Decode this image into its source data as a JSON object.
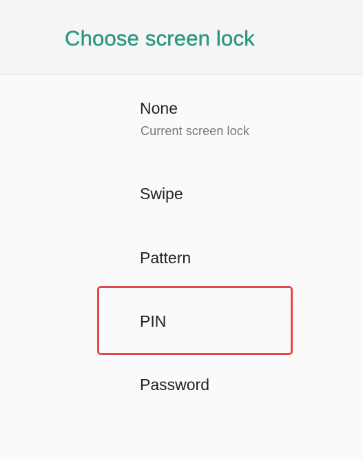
{
  "app_bar": {
    "title": "Choose screen lock",
    "title_color": "#2a9781"
  },
  "options": [
    {
      "title": "None",
      "summary": "Current screen lock"
    },
    {
      "title": "Swipe"
    },
    {
      "title": "Pattern"
    },
    {
      "title": "PIN",
      "highlighted": true
    },
    {
      "title": "Password"
    }
  ],
  "colors": {
    "highlight": "#e04a4a",
    "background": "#fafafa",
    "app_bar_background": "#f5f5f5"
  }
}
